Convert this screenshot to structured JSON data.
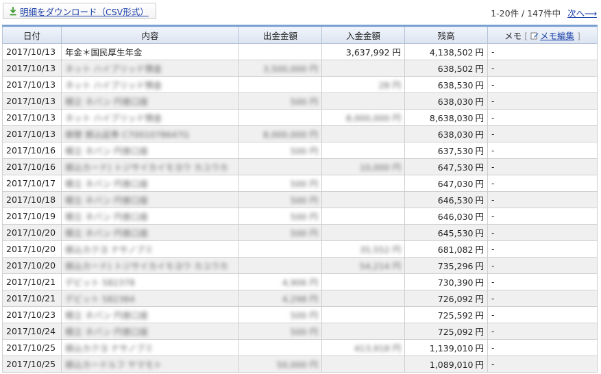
{
  "toolbar": {
    "download_label": "明細をダウンロード（CSV形式）",
    "page_info": "1-20件 / 147件中",
    "next_label": "次へ⟶"
  },
  "table": {
    "headers": {
      "date": "日付",
      "description": "内容",
      "withdrawal": "出金金額",
      "deposit": "入金金額",
      "balance": "残高",
      "memo": "メモ",
      "memo_bracket_open": "[",
      "memo_edit": "メモ編集",
      "memo_bracket_close": "]"
    },
    "currency_suffix": "円",
    "rows": [
      {
        "date": "2017/10/13",
        "description": "年金＊国民厚生年金",
        "withdrawal": "",
        "deposit": "3,637,992 円",
        "balance": "4,138,502",
        "memo": "-"
      },
      {
        "date": "2017/10/13",
        "description": "ネット ハイブリッド預金",
        "withdrawal": "3,500,000 円",
        "deposit": "",
        "balance": "638,502",
        "memo": "-"
      },
      {
        "date": "2017/10/13",
        "description": "ネット ハイブリッド預金",
        "withdrawal": "",
        "deposit": "28 円",
        "balance": "638,530",
        "memo": "-"
      },
      {
        "date": "2017/10/13",
        "description": "積立 ネバン 円普口座",
        "withdrawal": "500 円",
        "deposit": "",
        "balance": "638,030",
        "memo": "-"
      },
      {
        "date": "2017/10/13",
        "description": "ネット ハイブリッド預金",
        "withdrawal": "",
        "deposit": "8,000,000 円",
        "balance": "8,638,030",
        "memo": "-"
      },
      {
        "date": "2017/10/13",
        "description": "振替 振込証券 C7001078647G",
        "withdrawal": "8,000,000 円",
        "deposit": "",
        "balance": "638,030",
        "memo": "-"
      },
      {
        "date": "2017/10/16",
        "description": "積立 ネバン 円普口座",
        "withdrawal": "500 円",
        "deposit": "",
        "balance": "637,530",
        "memo": "-"
      },
      {
        "date": "2017/10/16",
        "description": "振込カード) トジサイカイモヨウ カユウカ",
        "withdrawal": "",
        "deposit": "10,000 円",
        "balance": "647,530",
        "memo": "-"
      },
      {
        "date": "2017/10/17",
        "description": "積立 ネバン 円普口座",
        "withdrawal": "500 円",
        "deposit": "",
        "balance": "647,030",
        "memo": "-"
      },
      {
        "date": "2017/10/18",
        "description": "積立 ネバン 円普口座",
        "withdrawal": "500 円",
        "deposit": "",
        "balance": "646,530",
        "memo": "-"
      },
      {
        "date": "2017/10/19",
        "description": "積立 ネバン 円普口座",
        "withdrawal": "500 円",
        "deposit": "",
        "balance": "646,030",
        "memo": "-"
      },
      {
        "date": "2017/10/20",
        "description": "積立 ネバン 円普口座",
        "withdrawal": "500 円",
        "deposit": "",
        "balance": "645,530",
        "memo": "-"
      },
      {
        "date": "2017/10/20",
        "description": "振込カクヨ ナサノブミ",
        "withdrawal": "",
        "deposit": "35,552 円",
        "balance": "681,082",
        "memo": "-"
      },
      {
        "date": "2017/10/20",
        "description": "振込カード) トジサイカイモヨウ カユウカ",
        "withdrawal": "",
        "deposit": "54,214 円",
        "balance": "735,296",
        "memo": "-"
      },
      {
        "date": "2017/10/21",
        "description": "デビット 582378",
        "withdrawal": "4,906 円",
        "deposit": "",
        "balance": "730,390",
        "memo": "-"
      },
      {
        "date": "2017/10/21",
        "description": "デビット 582384",
        "withdrawal": "4,298 円",
        "deposit": "",
        "balance": "726,092",
        "memo": "-"
      },
      {
        "date": "2017/10/23",
        "description": "積立 ネバン 円普口座",
        "withdrawal": "500 円",
        "deposit": "",
        "balance": "725,592",
        "memo": "-"
      },
      {
        "date": "2017/10/24",
        "description": "積立 ネバン 円普口座",
        "withdrawal": "500 円",
        "deposit": "",
        "balance": "725,092",
        "memo": "-"
      },
      {
        "date": "2017/10/25",
        "description": "振込カクヨ ナサノブミ",
        "withdrawal": "",
        "deposit": "413,918 円",
        "balance": "1,139,010",
        "memo": "-"
      },
      {
        "date": "2017/10/25",
        "description": "振込カードルフ ヤマモト",
        "withdrawal": "50,000 円",
        "deposit": "",
        "balance": "1,089,010",
        "memo": "-"
      }
    ]
  },
  "icons": {
    "download": "download-arrow-icon",
    "memo_edit": "pencil-edit-icon"
  },
  "colors": {
    "link": "#1a3fa8",
    "header_accent": "#7aa0d2",
    "zebra": "#f0f0f0"
  }
}
